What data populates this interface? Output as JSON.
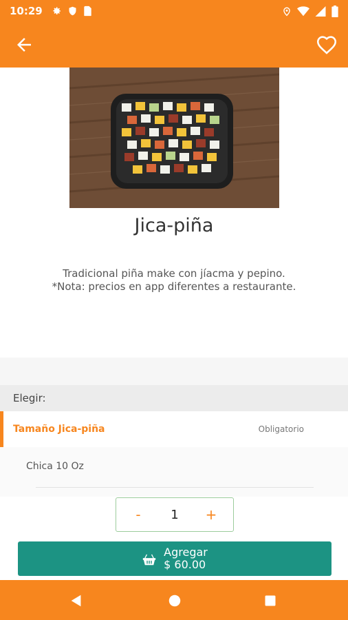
{
  "status_bar": {
    "time": "10:29",
    "left_icons": [
      "gear-icon",
      "shield-icon",
      "sim-card-icon"
    ],
    "right_icons": [
      "location-icon",
      "wifi-icon",
      "signal-icon",
      "battery-icon"
    ]
  },
  "app_bar": {
    "back_icon": "arrow-left-icon",
    "favorite_icon": "heart-outline-icon",
    "color": "#F7861E"
  },
  "product": {
    "title": "Jica-piña",
    "description_line1": "Tradicional piña make con jíacma y pepino.",
    "description_line2": "*Nota: precios en app diferentes a restaurante."
  },
  "options": {
    "section_label": "Elegir:",
    "group_name": "Tamaño Jica-piña",
    "group_required": "Obligatorio",
    "items": [
      {
        "label": "Chica 10 Oz"
      }
    ]
  },
  "quantity": {
    "minus": "-",
    "value": "1",
    "plus": "+"
  },
  "add_button": {
    "label": "Agregar",
    "price": "$ 60.00",
    "icon": "basket-icon",
    "color": "#1C9383"
  },
  "nav_bar": {
    "icons": [
      "nav-back-icon",
      "nav-home-icon",
      "nav-recent-icon"
    ]
  }
}
